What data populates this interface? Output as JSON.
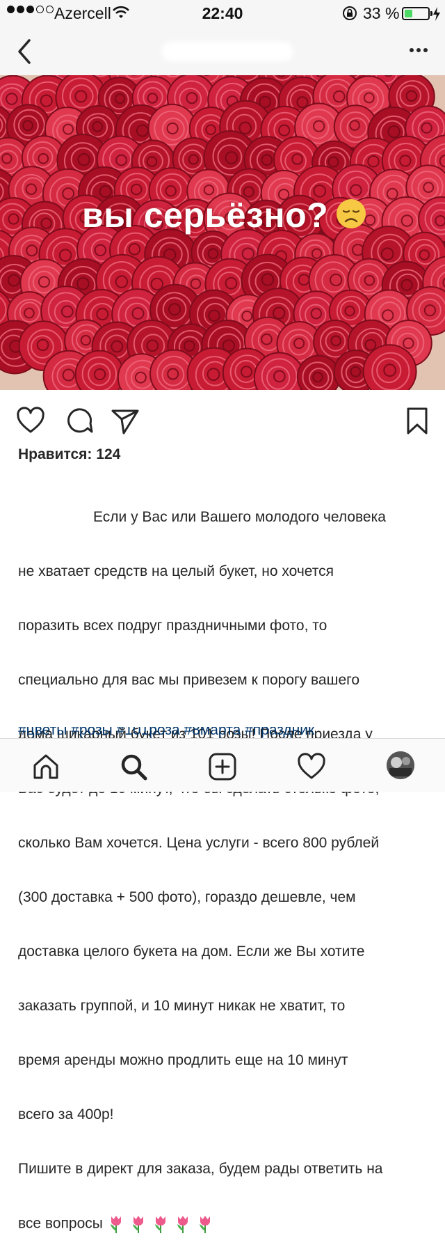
{
  "status_bar": {
    "carrier": "Azercell",
    "time": "22:40",
    "battery_percent": "33 %",
    "battery_level": 0.33
  },
  "nav": {
    "title": ""
  },
  "post": {
    "overlay_text": "вы серьёзно?",
    "overlay_emoji": "disappointed-face",
    "likes_label": "Нравится: 124",
    "caption_lines": [
      "Если у Вас или Вашего молодого человека",
      "не хватает средств на целый букет, но хочется",
      "поразить всех подруг праздничными фото, то",
      "специально для вас мы привезем к порогу вашего",
      "дома шикарный букет из 101 розы! После приезда у",
      "Вас будет до 10 минут, что бы сделать столько фото,",
      "сколько Вам хочется. Цена услуги - всего 800 рублей",
      "(300 доставка + 500 фото), гораздо дешевле, чем",
      "доставка целого букета на дом. Если же Вы хотите",
      "заказать группой, и 10 минут никак не хватит, то",
      "время аренды можно продлить еще на 10 минут",
      "всего за 400р!",
      "Пишите в директ для заказа, будем рады ответить на",
      "все вопросы"
    ],
    "caption_emoji": [
      "tulip",
      "tulip",
      "tulip",
      "tulip",
      "tulip"
    ],
    "hashtags": "#цветы #розы #101роза #8марта #праздник"
  },
  "icons": {
    "like": "heart-icon",
    "comment": "comment-icon",
    "share": "send-icon",
    "save": "bookmark-icon"
  },
  "tab_bar": {
    "items": [
      "home-icon",
      "search-icon",
      "add-post-icon",
      "activity-heart-icon",
      "profile-avatar"
    ]
  },
  "colors": {
    "rose": "#c81c34",
    "link": "#003569",
    "battery": "#4cd964"
  }
}
